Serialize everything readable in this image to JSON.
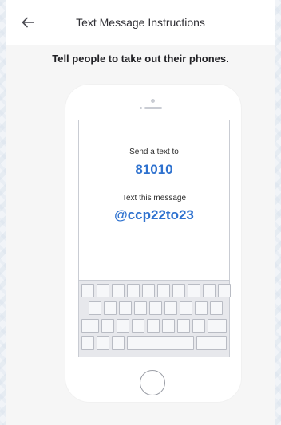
{
  "header": {
    "title": "Text Message Instructions",
    "back_icon": "arrow-left-icon"
  },
  "instruction": "Tell people to take out their phones.",
  "phone_screen": {
    "send_label": "Send a text to",
    "number": "81010",
    "message_label": "Text this message",
    "message": "@ccp22to23"
  },
  "colors": {
    "accent": "#2f72cf",
    "background": "#f6f6f6"
  }
}
